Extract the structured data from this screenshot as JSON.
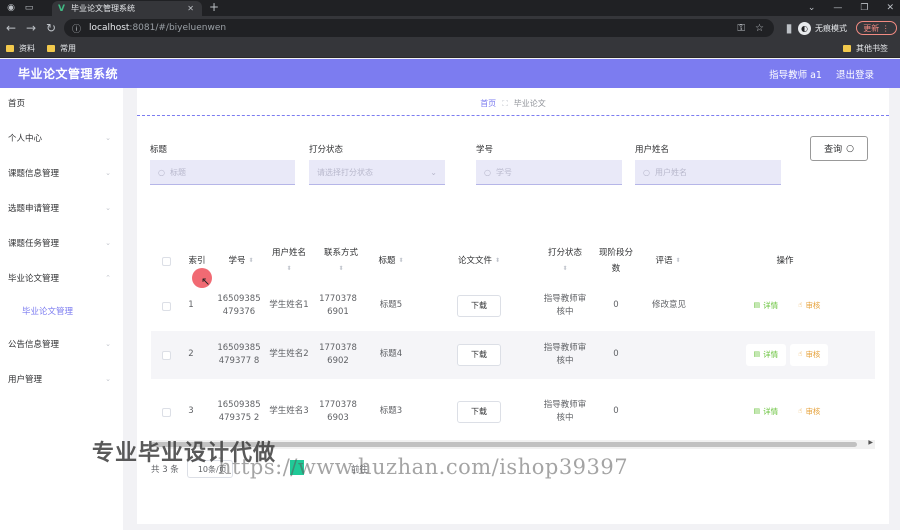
{
  "browser": {
    "tab_title": "毕业论文管理系统",
    "url_host": "localhost",
    "url_path": ":8081/#/biyeluenwen",
    "incognito_label": "无痕模式",
    "update_label": "更新",
    "bookmarks": [
      "资料",
      "常用"
    ],
    "other_bookmarks": "其他书签"
  },
  "header": {
    "title": "毕业论文管理系统",
    "user": "指导教师 a1",
    "logout": "退出登录",
    "accent": "#7c7cf0"
  },
  "sidebar": {
    "items": [
      {
        "label": "首页"
      },
      {
        "label": "个人中心"
      },
      {
        "label": "课题信息管理"
      },
      {
        "label": "选题申请管理"
      },
      {
        "label": "课题任务管理"
      },
      {
        "label": "毕业论文管理"
      },
      {
        "label": "毕业论文管理"
      },
      {
        "label": "公告信息管理"
      },
      {
        "label": "用户管理"
      }
    ]
  },
  "breadcrumb": {
    "home": "首页",
    "current": "毕业论文"
  },
  "filters": {
    "title": {
      "label": "标题",
      "placeholder": "标题"
    },
    "score_status": {
      "label": "打分状态",
      "placeholder": "请选择打分状态"
    },
    "student_no": {
      "label": "学号",
      "placeholder": "学号"
    },
    "user_name": {
      "label": "用户姓名",
      "placeholder": "用户姓名"
    },
    "query_label": "查询"
  },
  "table": {
    "columns": {
      "index": "索引",
      "student_no": "学号",
      "user_name": "用户姓名",
      "contact": "联系方式",
      "title": "标题",
      "file": "论文文件",
      "status": "打分状态",
      "score": "现阶段分数",
      "comment": "评语",
      "actions": "操作"
    },
    "rows": [
      {
        "index": "1",
        "student_no": "16509385479376",
        "user_name": "学生姓名1",
        "contact": "17703786901",
        "title": "标题5",
        "file": "下载",
        "status": "指导教师审核中",
        "score": "0",
        "comment": "修改意见",
        "view": "详情",
        "audit": "审核"
      },
      {
        "index": "2",
        "student_no": "16509385479377 8",
        "user_name": "学生姓名2",
        "contact": "17703786902",
        "title": "标题4",
        "file": "下载",
        "status": "指导教师审核中",
        "score": "0",
        "comment": "",
        "view": "详情",
        "audit": "审核"
      },
      {
        "index": "3",
        "student_no": "16509385479375 2",
        "user_name": "学生姓名3",
        "contact": "17703786903",
        "title": "标题3",
        "file": "下载",
        "status": "指导教师审核中",
        "score": "0",
        "comment": "",
        "view": "详情",
        "audit": "审核"
      }
    ]
  },
  "pager": {
    "total": "共 3 条",
    "size": "10条/页",
    "goto": "前往"
  },
  "watermark": {
    "cn": "专业毕业设计代做",
    "url": "https://www.huzhan.com/ishop39397"
  }
}
